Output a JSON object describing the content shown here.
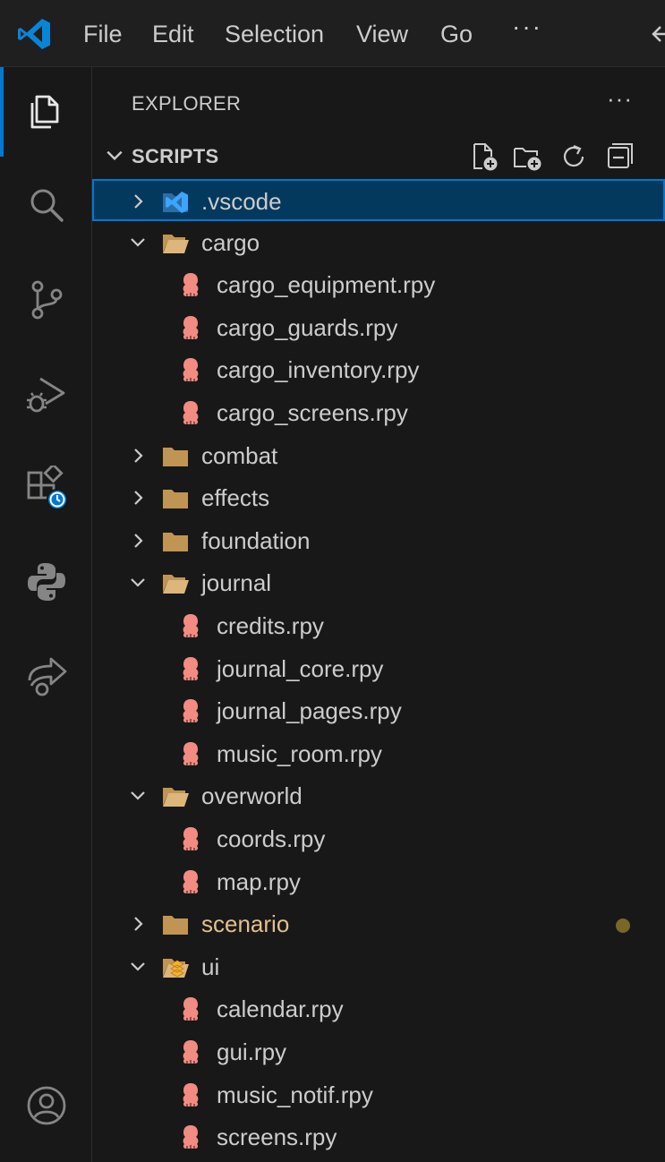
{
  "menubar": {
    "items": [
      "File",
      "Edit",
      "Selection",
      "View",
      "Go"
    ],
    "more": "···"
  },
  "activity_bar": {
    "items": [
      "explorer",
      "search",
      "source-control",
      "run-and-debug",
      "extensions",
      "python",
      "remote-explorer"
    ],
    "active": "explorer",
    "bottom": "accounts"
  },
  "explorer": {
    "title": "EXPLORER",
    "more": "···",
    "section": "SCRIPTS",
    "tree": [
      {
        "label": ".vscode",
        "type": "folder",
        "expanded": false,
        "selected": true,
        "icon": "vscode-folder-icon"
      },
      {
        "label": "cargo",
        "type": "folder",
        "expanded": true,
        "icon": "folder-open-icon"
      },
      {
        "label": "cargo_equipment.rpy",
        "type": "file",
        "icon": "renpy-file-icon"
      },
      {
        "label": "cargo_guards.rpy",
        "type": "file",
        "icon": "renpy-file-icon"
      },
      {
        "label": "cargo_inventory.rpy",
        "type": "file",
        "icon": "renpy-file-icon"
      },
      {
        "label": "cargo_screens.rpy",
        "type": "file",
        "icon": "renpy-file-icon"
      },
      {
        "label": "combat",
        "type": "folder",
        "expanded": false,
        "icon": "folder-icon"
      },
      {
        "label": "effects",
        "type": "folder",
        "expanded": false,
        "icon": "folder-icon"
      },
      {
        "label": "foundation",
        "type": "folder",
        "expanded": false,
        "icon": "folder-icon"
      },
      {
        "label": "journal",
        "type": "folder",
        "expanded": true,
        "icon": "folder-open-icon"
      },
      {
        "label": "credits.rpy",
        "type": "file",
        "icon": "renpy-file-icon"
      },
      {
        "label": "journal_core.rpy",
        "type": "file",
        "icon": "renpy-file-icon"
      },
      {
        "label": "journal_pages.rpy",
        "type": "file",
        "icon": "renpy-file-icon"
      },
      {
        "label": "music_room.rpy",
        "type": "file",
        "icon": "renpy-file-icon"
      },
      {
        "label": "overworld",
        "type": "folder",
        "expanded": true,
        "icon": "folder-open-icon"
      },
      {
        "label": "coords.rpy",
        "type": "file",
        "icon": "renpy-file-icon"
      },
      {
        "label": "map.rpy",
        "type": "file",
        "icon": "renpy-file-icon"
      },
      {
        "label": "scenario",
        "type": "folder",
        "expanded": false,
        "modified": true,
        "icon": "folder-icon"
      },
      {
        "label": "ui",
        "type": "folder",
        "expanded": true,
        "icon": "ui-folder-open-icon"
      },
      {
        "label": "calendar.rpy",
        "type": "file",
        "icon": "renpy-file-icon"
      },
      {
        "label": "gui.rpy",
        "type": "file",
        "icon": "renpy-file-icon"
      },
      {
        "label": "music_notif.rpy",
        "type": "file",
        "icon": "renpy-file-icon"
      },
      {
        "label": "screens.rpy",
        "type": "file",
        "icon": "renpy-file-icon"
      }
    ]
  },
  "colors": {
    "accent": "#0078d4",
    "selection_bg": "#04395e",
    "folder": "#c09553",
    "renpy_file": "#f28b82",
    "modified": "#e2c08d"
  }
}
